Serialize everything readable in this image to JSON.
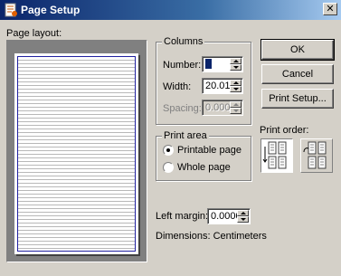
{
  "window": {
    "title": "Page Setup",
    "close_glyph": "✕"
  },
  "preview": {
    "label": "Page layout:"
  },
  "columns": {
    "group_label": "Columns",
    "number_label": "Number:",
    "number_value": "",
    "width_label": "Width:",
    "width_value": "20.011",
    "spacing_label": "Spacing:",
    "spacing_value": "0.000"
  },
  "print_area": {
    "group_label": "Print area",
    "options": [
      "Printable page",
      "Whole page"
    ],
    "selected": "Printable page"
  },
  "left_margin": {
    "label": "Left margin:",
    "value": "0.0000"
  },
  "dimensions": {
    "label": "Dimensions: Centimeters"
  },
  "buttons": {
    "ok": "OK",
    "cancel": "Cancel",
    "print_setup": "Print Setup..."
  },
  "print_order": {
    "label": "Print order:",
    "options": [
      "down-then-over",
      "over-then-down"
    ],
    "selected": "down-then-over"
  },
  "icons": {
    "app": "page-setup-app-icon",
    "close": "close-icon",
    "spin_up": "chevron-up-icon",
    "spin_down": "chevron-down-icon"
  }
}
